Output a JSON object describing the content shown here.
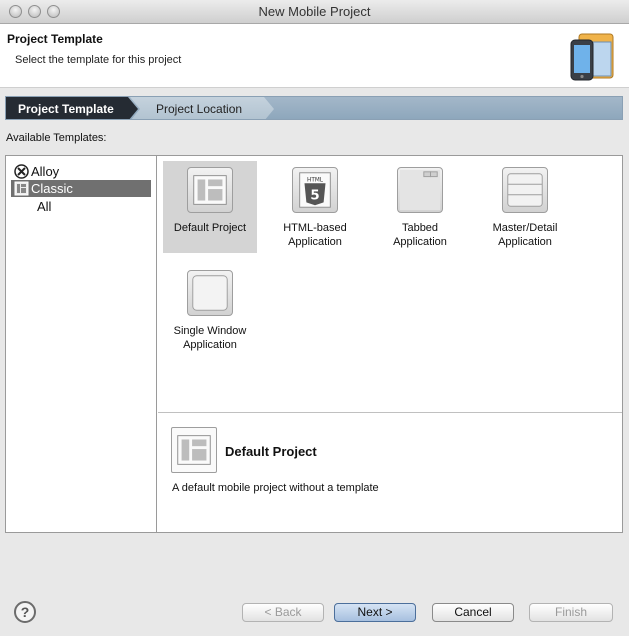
{
  "window": {
    "title": "New Mobile Project"
  },
  "header": {
    "title": "Project Template",
    "subtitle": "Select the template for this project",
    "icon": "mobile-project-icon"
  },
  "wizard_steps": [
    {
      "label": "Project Template",
      "active": true
    },
    {
      "label": "Project Location",
      "active": false
    }
  ],
  "available_label": "Available Templates:",
  "categories": [
    {
      "label": "Alloy",
      "icon": "alloy-icon",
      "selected": false
    },
    {
      "label": "Classic",
      "icon": "classic-icon",
      "selected": true
    },
    {
      "label": "All",
      "icon": "",
      "selected": false
    }
  ],
  "templates": [
    {
      "line1": "Default Project",
      "line2": "",
      "icon": "default-project-icon",
      "selected": true
    },
    {
      "line1": "HTML-based",
      "line2": "Application",
      "icon": "html5-icon",
      "selected": false
    },
    {
      "line1": "Tabbed",
      "line2": "Application",
      "icon": "tabbed-icon",
      "selected": false
    },
    {
      "line1": "Master/Detail",
      "line2": "Application",
      "icon": "master-detail-icon",
      "selected": false
    },
    {
      "line1": "Single Window",
      "line2": "Application",
      "icon": "single-window-icon",
      "selected": false
    }
  ],
  "description": {
    "title": "Default Project",
    "text": "A default mobile project without a template"
  },
  "buttons": {
    "help": "?",
    "back": "< Back",
    "next": "Next >",
    "cancel": "Cancel",
    "finish": "Finish"
  }
}
